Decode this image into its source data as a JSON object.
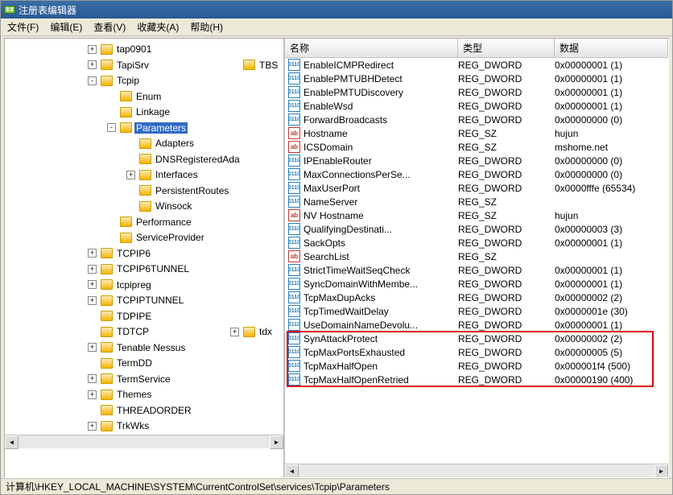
{
  "window": {
    "title": "注册表编辑器"
  },
  "menu": {
    "file": "文件(F)",
    "edit": "编辑(E)",
    "view": "查看(V)",
    "favorites": "收藏夹(A)",
    "help": "帮助(H)"
  },
  "columns": {
    "name": "名称",
    "type": "类型",
    "data": "数据"
  },
  "tree": {
    "items": [
      {
        "i": 8,
        "e": "+",
        "l": "tap0901"
      },
      {
        "i": 8,
        "e": "+",
        "l": "TapiSrv"
      },
      {
        "i": 8,
        "e": "",
        "l": "TBS"
      },
      {
        "i": 8,
        "e": "-",
        "l": "Tcpip"
      },
      {
        "i": 10,
        "e": "",
        "l": "Enum"
      },
      {
        "i": 10,
        "e": "",
        "l": "Linkage"
      },
      {
        "i": 10,
        "e": "-",
        "l": "Parameters",
        "sel": true
      },
      {
        "i": 12,
        "e": "",
        "l": "Adapters"
      },
      {
        "i": 12,
        "e": "",
        "l": "DNSRegisteredAda"
      },
      {
        "i": 12,
        "e": "+",
        "l": "Interfaces"
      },
      {
        "i": 12,
        "e": "",
        "l": "PersistentRoutes"
      },
      {
        "i": 12,
        "e": "",
        "l": "Winsock"
      },
      {
        "i": 10,
        "e": "",
        "l": "Performance"
      },
      {
        "i": 10,
        "e": "",
        "l": "ServiceProvider"
      },
      {
        "i": 8,
        "e": "+",
        "l": "TCPIP6"
      },
      {
        "i": 8,
        "e": "+",
        "l": "TCPIP6TUNNEL"
      },
      {
        "i": 8,
        "e": "+",
        "l": "tcpipreg"
      },
      {
        "i": 8,
        "e": "+",
        "l": "TCPIPTUNNEL"
      },
      {
        "i": 8,
        "e": "",
        "l": "TDPIPE"
      },
      {
        "i": 8,
        "e": "",
        "l": "TDTCP"
      },
      {
        "i": 8,
        "e": "+",
        "l": "tdx"
      },
      {
        "i": 8,
        "e": "+",
        "l": "Tenable Nessus"
      },
      {
        "i": 8,
        "e": "",
        "l": "TermDD"
      },
      {
        "i": 8,
        "e": "+",
        "l": "TermService"
      },
      {
        "i": 8,
        "e": "+",
        "l": "Themes"
      },
      {
        "i": 8,
        "e": "",
        "l": "THREADORDER"
      },
      {
        "i": 8,
        "e": "+",
        "l": "TrkWks"
      }
    ]
  },
  "values": [
    {
      "n": "EnableICMPRedirect",
      "t": "REG_DWORD",
      "d": "0x00000001 (1)",
      "k": "dw"
    },
    {
      "n": "EnablePMTUBHDetect",
      "t": "REG_DWORD",
      "d": "0x00000001 (1)",
      "k": "dw"
    },
    {
      "n": "EnablePMTUDiscovery",
      "t": "REG_DWORD",
      "d": "0x00000001 (1)",
      "k": "dw"
    },
    {
      "n": "EnableWsd",
      "t": "REG_DWORD",
      "d": "0x00000001 (1)",
      "k": "dw"
    },
    {
      "n": "ForwardBroadcasts",
      "t": "REG_DWORD",
      "d": "0x00000000 (0)",
      "k": "dw"
    },
    {
      "n": "Hostname",
      "t": "REG_SZ",
      "d": "hujun",
      "k": "sz"
    },
    {
      "n": "ICSDomain",
      "t": "REG_SZ",
      "d": "mshome.net",
      "k": "sz"
    },
    {
      "n": "IPEnableRouter",
      "t": "REG_DWORD",
      "d": "0x00000000 (0)",
      "k": "dw"
    },
    {
      "n": "MaxConnectionsPerSe...",
      "t": "REG_DWORD",
      "d": "0x00000000 (0)",
      "k": "dw"
    },
    {
      "n": "MaxUserPort",
      "t": "REG_DWORD",
      "d": "0x0000fffe (65534)",
      "k": "dw"
    },
    {
      "n": "NameServer",
      "t": "REG_SZ",
      "d": "",
      "k": "dw"
    },
    {
      "n": "NV Hostname",
      "t": "REG_SZ",
      "d": "hujun",
      "k": "sz"
    },
    {
      "n": "QualifyingDestinati...",
      "t": "REG_DWORD",
      "d": "0x00000003 (3)",
      "k": "dw"
    },
    {
      "n": "SackOpts",
      "t": "REG_DWORD",
      "d": "0x00000001 (1)",
      "k": "dw"
    },
    {
      "n": "SearchList",
      "t": "REG_SZ",
      "d": "",
      "k": "sz"
    },
    {
      "n": "StrictTimeWaitSeqCheck",
      "t": "REG_DWORD",
      "d": "0x00000001 (1)",
      "k": "dw"
    },
    {
      "n": "SyncDomainWithMembe...",
      "t": "REG_DWORD",
      "d": "0x00000001 (1)",
      "k": "dw"
    },
    {
      "n": "TcpMaxDupAcks",
      "t": "REG_DWORD",
      "d": "0x00000002 (2)",
      "k": "dw"
    },
    {
      "n": "TcpTimedWaitDelay",
      "t": "REG_DWORD",
      "d": "0x0000001e (30)",
      "k": "dw"
    },
    {
      "n": "UseDomainNameDevolu...",
      "t": "REG_DWORD",
      "d": "0x00000001 (1)",
      "k": "dw"
    },
    {
      "n": "SynAttackProtect",
      "t": "REG_DWORD",
      "d": "0x00000002 (2)",
      "k": "dw",
      "hl": true
    },
    {
      "n": "TcpMaxPortsExhausted",
      "t": "REG_DWORD",
      "d": "0x00000005 (5)",
      "k": "dw",
      "hl": true
    },
    {
      "n": "TcpMaxHalfOpen",
      "t": "REG_DWORD",
      "d": "0x000001f4 (500)",
      "k": "dw",
      "hl": true
    },
    {
      "n": "TcpMaxHalfOpenRetried",
      "t": "REG_DWORD",
      "d": "0x00000190 (400)",
      "k": "dw",
      "hl": true
    }
  ],
  "statusbar": {
    "path": "计算机\\HKEY_LOCAL_MACHINE\\SYSTEM\\CurrentControlSet\\services\\Tcpip\\Parameters"
  }
}
